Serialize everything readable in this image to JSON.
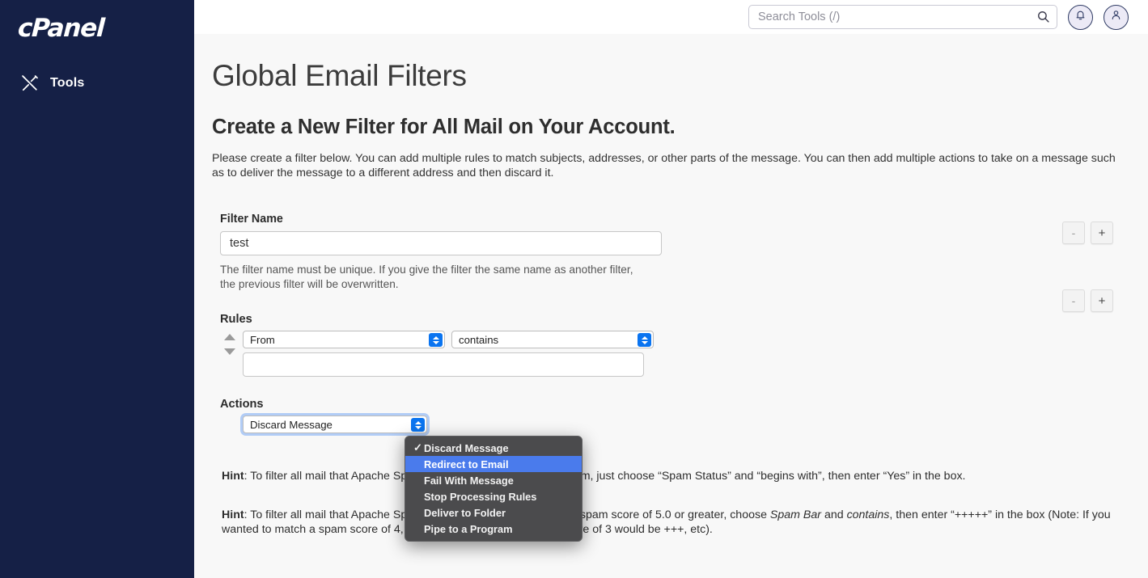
{
  "sidebar": {
    "logo_text": "cPanel",
    "nav": [
      {
        "label": "Tools",
        "icon": "tools-icon"
      }
    ]
  },
  "topbar": {
    "search": {
      "placeholder": "Search Tools (/)",
      "value": "",
      "icon": "search-icon"
    },
    "notifications_icon": "bell-icon",
    "account_icon": "user-icon"
  },
  "main": {
    "page_title": "Global Email Filters",
    "section_title": "Create a New Filter for All Mail on Your Account.",
    "description": "Please create a filter below. You can add multiple rules to match subjects, addresses, or other parts of the message. You can then add multiple actions to take on a message such as to deliver the message to a different address and then discard it.",
    "filter_name": {
      "label": "Filter Name",
      "value": "test",
      "placeholder": "",
      "help": "The filter name must be unique. If you give the filter the same name as another filter, the previous filter will be overwritten."
    },
    "rules": {
      "label": "Rules",
      "field_select": "From",
      "operator_select": "contains",
      "value": "",
      "value_placeholder": "",
      "move_up_icon": "caret-up-icon",
      "move_down_icon": "caret-down-icon",
      "remove_label": "-",
      "add_label": "+"
    },
    "actions": {
      "label": "Actions",
      "action_select": "Discard Message",
      "remove_label": "-",
      "add_label": "+"
    },
    "hints": {
      "hint1_prefix": "Hint",
      "hint1_colon": ": ",
      "hint1_hidden_start": "To filter all mail that Apach",
      "hint1_text": "e SpamAssassin™ has marked as spam, just choose “Spam Status” and “begins with”, then enter “Yes” in the box.",
      "hint2_prefix": "Hint",
      "hint2_a": ": To filter all mail that Apache SpamAssassin™ has marked with a spam score of 5.0 or greater, choose ",
      "hint2_em1": "Spam Bar",
      "hint2_b": " and ",
      "hint2_em2": "contains",
      "hint2_c": ", then enter “+++++” in the box (Note: If you wanted to match a spam score of 4, you would use ++++`. A spam score of 3 would be +++, etc)."
    }
  },
  "dropdown": {
    "open": true,
    "items": [
      {
        "label": "Discard Message",
        "checked": true,
        "highlighted": false
      },
      {
        "label": "Redirect to Email",
        "checked": false,
        "highlighted": true
      },
      {
        "label": "Fail With Message",
        "checked": false,
        "highlighted": false
      },
      {
        "label": "Stop Processing Rules",
        "checked": false,
        "highlighted": false
      },
      {
        "label": "Deliver to Folder",
        "checked": false,
        "highlighted": false
      },
      {
        "label": "Pipe to a Program",
        "checked": false,
        "highlighted": false
      }
    ],
    "check_glyph": "✓"
  },
  "colors": {
    "sidebar_bg": "#152046",
    "content_bg": "#f8f8f8",
    "accent_blue": "#0a74f0",
    "menu_highlight": "#4a7bec",
    "menu_bg": "#4b4b4d",
    "icon_circle_bg": "#eceaf6"
  }
}
